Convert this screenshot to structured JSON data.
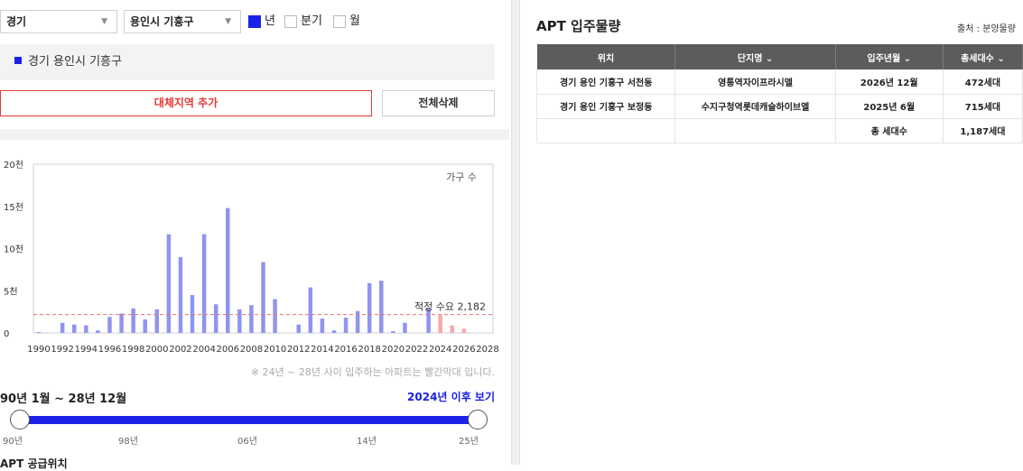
{
  "filters": {
    "province": "경기",
    "city": "용인시 기흥구",
    "period_options": [
      {
        "label": "년",
        "checked": true
      },
      {
        "label": "분기",
        "checked": false
      },
      {
        "label": "월",
        "checked": false
      }
    ]
  },
  "selected_region": "경기 용인시 기흥구",
  "buttons": {
    "add_region": "대체지역 추가",
    "delete_all": "전체삭제"
  },
  "chart_data": {
    "type": "bar",
    "title": "",
    "legend": "가구 수",
    "yticks": [
      "0",
      "5천",
      "10천",
      "15천",
      "20천"
    ],
    "ylim": [
      0,
      20000
    ],
    "xticks": [
      "1990",
      "1992",
      "1994",
      "1996",
      "1998",
      "2000",
      "2002",
      "2004",
      "2006",
      "2008",
      "2010",
      "2012",
      "2014",
      "2016",
      "2018",
      "2020",
      "2022",
      "2024",
      "2026",
      "2028"
    ],
    "categories": [
      1990,
      1991,
      1992,
      1993,
      1994,
      1995,
      1996,
      1997,
      1998,
      1999,
      2000,
      2001,
      2002,
      2003,
      2004,
      2005,
      2006,
      2007,
      2008,
      2009,
      2010,
      2011,
      2012,
      2013,
      2014,
      2015,
      2016,
      2017,
      2018,
      2019,
      2020,
      2021,
      2022,
      2023,
      2024,
      2025,
      2026
    ],
    "values": [
      100,
      0,
      1200,
      1000,
      900,
      300,
      1900,
      2300,
      2900,
      1600,
      2800,
      11700,
      9000,
      4500,
      11700,
      3400,
      14800,
      2800,
      3300,
      8400,
      4000,
      0,
      1000,
      5400,
      1700,
      300,
      1800,
      2600,
      5900,
      6200,
      200,
      1200,
      0,
      2900,
      2100,
      900,
      500
    ],
    "highlight_from": 2024,
    "reference_line": {
      "label": "적정 수요 2,182",
      "value": 2182
    },
    "colors": {
      "bar": "#8f95ee",
      "highlight": "#f7a9a9",
      "reference": "#e57373"
    }
  },
  "chart_note": "※ 24년 ~ 28년 사이 입주하는 아파트는 빨간막대 입니다.",
  "period_label": "90년 1월 ~ 28년 12월",
  "after_2024_link": "2024년 이후 보기",
  "slider": {
    "ticks": [
      "90년",
      "98년",
      "06년",
      "14년",
      "25년"
    ],
    "range": [
      "90년",
      "25년"
    ]
  },
  "supply_section_title": "APT 공급위치",
  "right_panel": {
    "title": "APT 입주물량",
    "source": "출처 : 분양물량",
    "columns": [
      "위치",
      "단지명 ⌄",
      "입주년월 ⌄",
      "총세대수 ⌄"
    ],
    "rows": [
      [
        "경기 용인 기흥구 서천동",
        "영통역자이프라시엘",
        "2026년 12월",
        "472세대"
      ],
      [
        "경기 용인 기흥구 보정동",
        "수지구청역롯데캐슬하이브엘",
        "2025년 6월",
        "715세대"
      ],
      [
        "",
        "",
        "총 세대수",
        "1,187세대"
      ]
    ]
  },
  "theme": {
    "accent": "#1a22e8",
    "danger": "#e53935",
    "header_bg": "#5c5c5c"
  }
}
